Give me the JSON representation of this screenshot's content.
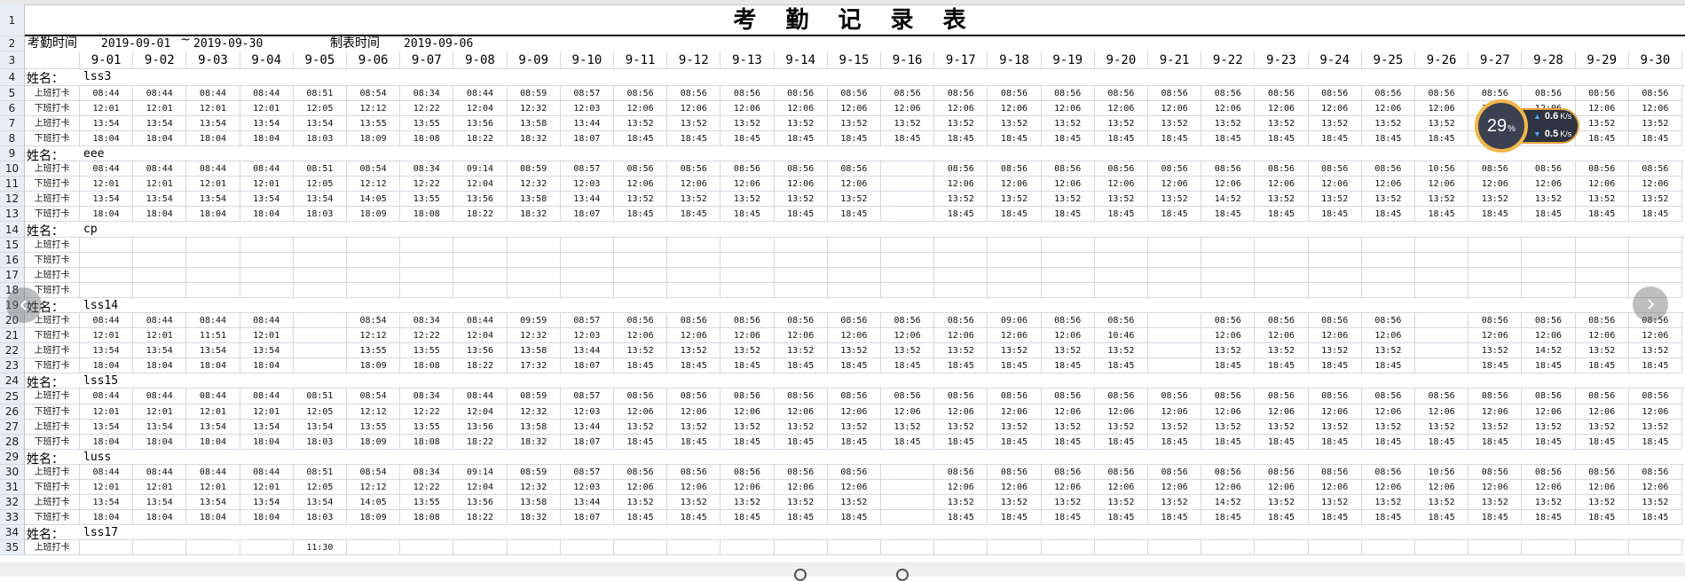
{
  "title": "考 勤 记 录 表",
  "header": {
    "period_label": "考勤时间",
    "start_date": "2019-09-01",
    "separator": "~",
    "end_date": "2019-09-30",
    "created_label": "制表时间",
    "created_date": "2019-09-06"
  },
  "dates": [
    "9-01",
    "9-02",
    "9-03",
    "9-04",
    "9-05",
    "9-06",
    "9-07",
    "9-08",
    "9-09",
    "9-10",
    "9-11",
    "9-12",
    "9-13",
    "9-14",
    "9-15",
    "9-16",
    "9-17",
    "9-18",
    "9-19",
    "9-20",
    "9-21",
    "9-22",
    "9-23",
    "9-24",
    "9-25",
    "9-26",
    "9-27",
    "9-28",
    "9-29",
    "9-30"
  ],
  "row_numbers": [
    "1",
    "2",
    "3",
    "4",
    "5",
    "6",
    "7",
    "8",
    "9",
    "10",
    "11",
    "12",
    "13",
    "14",
    "15",
    "16",
    "17",
    "18",
    "19",
    "20",
    "21",
    "22",
    "23",
    "24",
    "25",
    "26",
    "27",
    "28",
    "29",
    "30",
    "31",
    "32",
    "33",
    "34",
    "35"
  ],
  "name_label": "姓名：",
  "punch_labels": [
    "上班打卡",
    "下班打卡",
    "上班打卡",
    "下班打卡"
  ],
  "employees": [
    {
      "name": "lss3",
      "rows": [
        [
          "08:44",
          "08:44",
          "08:44",
          "08:44",
          "08:51",
          "08:54",
          "08:34",
          "08:44",
          "08:59",
          "08:57",
          "08:56",
          "08:56",
          "08:56",
          "08:56",
          "08:56",
          "08:56",
          "08:56",
          "08:56",
          "08:56",
          "08:56",
          "08:56",
          "08:56",
          "08:56",
          "08:56",
          "08:56",
          "08:56",
          "08:56",
          "08:56",
          "08:56",
          "08:56"
        ],
        [
          "12:01",
          "12:01",
          "12:01",
          "12:01",
          "12:05",
          "12:12",
          "12:22",
          "12:04",
          "12:32",
          "12:03",
          "12:06",
          "12:06",
          "12:06",
          "12:06",
          "12:06",
          "12:06",
          "12:06",
          "12:06",
          "12:06",
          "12:06",
          "12:06",
          "12:06",
          "12:06",
          "12:06",
          "12:06",
          "12:06",
          "12:06",
          "12:06",
          "12:06",
          "12:06"
        ],
        [
          "13:54",
          "13:54",
          "13:54",
          "13:54",
          "13:54",
          "13:55",
          "13:55",
          "13:56",
          "13:58",
          "13:44",
          "13:52",
          "13:52",
          "13:52",
          "13:52",
          "13:52",
          "13:52",
          "13:52",
          "13:52",
          "13:52",
          "13:52",
          "13:52",
          "13:52",
          "13:52",
          "13:52",
          "13:52",
          "13:52",
          "13:52",
          "13:52",
          "13:52",
          "13:52"
        ],
        [
          "18:04",
          "18:04",
          "18:04",
          "18:04",
          "18:03",
          "18:09",
          "18:08",
          "18:22",
          "18:32",
          "18:07",
          "18:45",
          "18:45",
          "18:45",
          "18:45",
          "18:45",
          "18:45",
          "18:45",
          "18:45",
          "18:45",
          "18:45",
          "18:45",
          "18:45",
          "18:45",
          "18:45",
          "18:45",
          "18:45",
          "18:45",
          "18:45",
          "18:45",
          "18:45"
        ]
      ]
    },
    {
      "name": "eee",
      "rows": [
        [
          "08:44",
          "08:44",
          "08:44",
          "08:44",
          "08:51",
          "08:54",
          "08:34",
          "09:14",
          "08:59",
          "08:57",
          "08:56",
          "08:56",
          "08:56",
          "08:56",
          "08:56",
          "",
          "08:56",
          "08:56",
          "08:56",
          "08:56",
          "08:56",
          "08:56",
          "08:56",
          "08:56",
          "08:56",
          "10:56",
          "08:56",
          "08:56",
          "08:56",
          "08:56"
        ],
        [
          "12:01",
          "12:01",
          "12:01",
          "12:01",
          "12:05",
          "12:12",
          "12:22",
          "12:04",
          "12:32",
          "12:03",
          "12:06",
          "12:06",
          "12:06",
          "12:06",
          "12:06",
          "",
          "12:06",
          "12:06",
          "12:06",
          "12:06",
          "12:06",
          "12:06",
          "12:06",
          "12:06",
          "12:06",
          "12:06",
          "12:06",
          "12:06",
          "12:06",
          "12:06"
        ],
        [
          "13:54",
          "13:54",
          "13:54",
          "13:54",
          "13:54",
          "14:05",
          "13:55",
          "13:56",
          "13:58",
          "13:44",
          "13:52",
          "13:52",
          "13:52",
          "13:52",
          "13:52",
          "",
          "13:52",
          "13:52",
          "13:52",
          "13:52",
          "13:52",
          "14:52",
          "13:52",
          "13:52",
          "13:52",
          "13:52",
          "13:52",
          "13:52",
          "13:52",
          "13:52"
        ],
        [
          "18:04",
          "18:04",
          "18:04",
          "18:04",
          "18:03",
          "18:09",
          "18:08",
          "18:22",
          "18:32",
          "18:07",
          "18:45",
          "18:45",
          "18:45",
          "18:45",
          "18:45",
          "",
          "18:45",
          "18:45",
          "18:45",
          "18:45",
          "18:45",
          "18:45",
          "18:45",
          "18:45",
          "18:45",
          "18:45",
          "18:45",
          "18:45",
          "18:45",
          "18:45"
        ]
      ]
    },
    {
      "name": "cp",
      "rows": [
        [
          "",
          "",
          "",
          "",
          "",
          "",
          "",
          "",
          "",
          "",
          "",
          "",
          "",
          "",
          "",
          "",
          "",
          "",
          "",
          "",
          "",
          "",
          "",
          "",
          "",
          "",
          "",
          "",
          "",
          ""
        ],
        [
          "",
          "",
          "",
          "",
          "",
          "",
          "",
          "",
          "",
          "",
          "",
          "",
          "",
          "",
          "",
          "",
          "",
          "",
          "",
          "",
          "",
          "",
          "",
          "",
          "",
          "",
          "",
          "",
          "",
          ""
        ],
        [
          "",
          "",
          "",
          "",
          "",
          "",
          "",
          "",
          "",
          "",
          "",
          "",
          "",
          "",
          "",
          "",
          "",
          "",
          "",
          "",
          "",
          "",
          "",
          "",
          "",
          "",
          "",
          "",
          "",
          ""
        ],
        [
          "",
          "",
          "",
          "",
          "",
          "",
          "",
          "",
          "",
          "",
          "",
          "",
          "",
          "",
          "",
          "",
          "",
          "",
          "",
          "",
          "",
          "",
          "",
          "",
          "",
          "",
          "",
          "",
          "",
          ""
        ]
      ]
    },
    {
      "name": "lss14",
      "rows": [
        [
          "08:44",
          "08:44",
          "08:44",
          "08:44",
          "",
          "08:54",
          "08:34",
          "08:44",
          "09:59",
          "08:57",
          "08:56",
          "08:56",
          "08:56",
          "08:56",
          "08:56",
          "08:56",
          "08:56",
          "09:06",
          "08:56",
          "08:56",
          "",
          "08:56",
          "08:56",
          "08:56",
          "08:56",
          "",
          "08:56",
          "08:56",
          "08:56",
          "08:56"
        ],
        [
          "12:01",
          "12:01",
          "11:51",
          "12:01",
          "",
          "12:12",
          "12:22",
          "12:04",
          "12:32",
          "12:03",
          "12:06",
          "12:06",
          "12:06",
          "12:06",
          "12:06",
          "12:06",
          "12:06",
          "12:06",
          "12:06",
          "10:46",
          "",
          "12:06",
          "12:06",
          "12:06",
          "12:06",
          "",
          "12:06",
          "12:06",
          "12:06",
          "12:06"
        ],
        [
          "13:54",
          "13:54",
          "13:54",
          "13:54",
          "",
          "13:55",
          "13:55",
          "13:56",
          "13:58",
          "13:44",
          "13:52",
          "13:52",
          "13:52",
          "13:52",
          "13:52",
          "13:52",
          "13:52",
          "13:52",
          "13:52",
          "13:52",
          "",
          "13:52",
          "13:52",
          "13:52",
          "13:52",
          "",
          "13:52",
          "14:52",
          "13:52",
          "13:52"
        ],
        [
          "18:04",
          "18:04",
          "18:04",
          "18:04",
          "",
          "18:09",
          "18:08",
          "18:22",
          "17:32",
          "18:07",
          "18:45",
          "18:45",
          "18:45",
          "18:45",
          "18:45",
          "18:45",
          "18:45",
          "18:45",
          "18:45",
          "18:45",
          "",
          "18:45",
          "18:45",
          "18:45",
          "18:45",
          "",
          "18:45",
          "18:45",
          "18:45",
          "18:45"
        ]
      ]
    },
    {
      "name": "lss15",
      "rows": [
        [
          "08:44",
          "08:44",
          "08:44",
          "08:44",
          "08:51",
          "08:54",
          "08:34",
          "08:44",
          "08:59",
          "08:57",
          "08:56",
          "08:56",
          "08:56",
          "08:56",
          "08:56",
          "08:56",
          "08:56",
          "08:56",
          "08:56",
          "08:56",
          "08:56",
          "08:56",
          "08:56",
          "08:56",
          "08:56",
          "08:56",
          "08:56",
          "08:56",
          "08:56",
          "08:56"
        ],
        [
          "12:01",
          "12:01",
          "12:01",
          "12:01",
          "12:05",
          "12:12",
          "12:22",
          "12:04",
          "12:32",
          "12:03",
          "12:06",
          "12:06",
          "12:06",
          "12:06",
          "12:06",
          "12:06",
          "12:06",
          "12:06",
          "12:06",
          "12:06",
          "12:06",
          "12:06",
          "12:06",
          "12:06",
          "12:06",
          "12:06",
          "12:06",
          "12:06",
          "12:06",
          "12:06"
        ],
        [
          "13:54",
          "13:54",
          "13:54",
          "13:54",
          "13:54",
          "13:55",
          "13:55",
          "13:56",
          "13:58",
          "13:44",
          "13:52",
          "13:52",
          "13:52",
          "13:52",
          "13:52",
          "13:52",
          "13:52",
          "13:52",
          "13:52",
          "13:52",
          "13:52",
          "13:52",
          "13:52",
          "13:52",
          "13:52",
          "13:52",
          "13:52",
          "13:52",
          "13:52",
          "13:52"
        ],
        [
          "18:04",
          "18:04",
          "18:04",
          "18:04",
          "18:03",
          "18:09",
          "18:08",
          "18:22",
          "18:32",
          "18:07",
          "18:45",
          "18:45",
          "18:45",
          "18:45",
          "18:45",
          "18:45",
          "18:45",
          "18:45",
          "18:45",
          "18:45",
          "18:45",
          "18:45",
          "18:45",
          "18:45",
          "18:45",
          "18:45",
          "18:45",
          "18:45",
          "18:45",
          "18:45"
        ]
      ]
    },
    {
      "name": "luss",
      "rows": [
        [
          "08:44",
          "08:44",
          "08:44",
          "08:44",
          "08:51",
          "08:54",
          "08:34",
          "09:14",
          "08:59",
          "08:57",
          "08:56",
          "08:56",
          "08:56",
          "08:56",
          "08:56",
          "",
          "08:56",
          "08:56",
          "08:56",
          "08:56",
          "08:56",
          "08:56",
          "08:56",
          "08:56",
          "08:56",
          "10:56",
          "08:56",
          "08:56",
          "08:56",
          "08:56"
        ],
        [
          "12:01",
          "12:01",
          "12:01",
          "12:01",
          "12:05",
          "12:12",
          "12:22",
          "12:04",
          "12:32",
          "12:03",
          "12:06",
          "12:06",
          "12:06",
          "12:06",
          "12:06",
          "",
          "12:06",
          "12:06",
          "12:06",
          "12:06",
          "12:06",
          "12:06",
          "12:06",
          "12:06",
          "12:06",
          "12:06",
          "12:06",
          "12:06",
          "12:06",
          "12:06"
        ],
        [
          "13:54",
          "13:54",
          "13:54",
          "13:54",
          "13:54",
          "14:05",
          "13:55",
          "13:56",
          "13:58",
          "13:44",
          "13:52",
          "13:52",
          "13:52",
          "13:52",
          "13:52",
          "",
          "13:52",
          "13:52",
          "13:52",
          "13:52",
          "13:52",
          "14:52",
          "13:52",
          "13:52",
          "13:52",
          "13:52",
          "13:52",
          "13:52",
          "13:52",
          "13:52"
        ],
        [
          "18:04",
          "18:04",
          "18:04",
          "18:04",
          "18:03",
          "18:09",
          "18:08",
          "18:22",
          "18:32",
          "18:07",
          "18:45",
          "18:45",
          "18:45",
          "18:45",
          "18:45",
          "",
          "18:45",
          "18:45",
          "18:45",
          "18:45",
          "18:45",
          "18:45",
          "18:45",
          "18:45",
          "18:45",
          "18:45",
          "18:45",
          "18:45",
          "18:45",
          "18:45"
        ]
      ]
    },
    {
      "name": "lss17",
      "rows": [
        [
          "",
          "",
          "",
          "",
          "11:30",
          "",
          "",
          "",
          "",
          "",
          "",
          "",
          "",
          "",
          "",
          "",
          "",
          "",
          "",
          "",
          "",
          "",
          "",
          "",
          "",
          "",
          "",
          "",
          "",
          ""
        ]
      ]
    }
  ],
  "speed_widget": {
    "percent": "29",
    "percent_unit": "%",
    "up_value": "0.6",
    "up_unit": "K/s",
    "down_value": "0.5",
    "down_unit": "K/s",
    "ring_color": "#f1b64a"
  },
  "icons": {
    "nav_prev": "chevron-left-icon",
    "nav_next": "chevron-right-icon"
  }
}
